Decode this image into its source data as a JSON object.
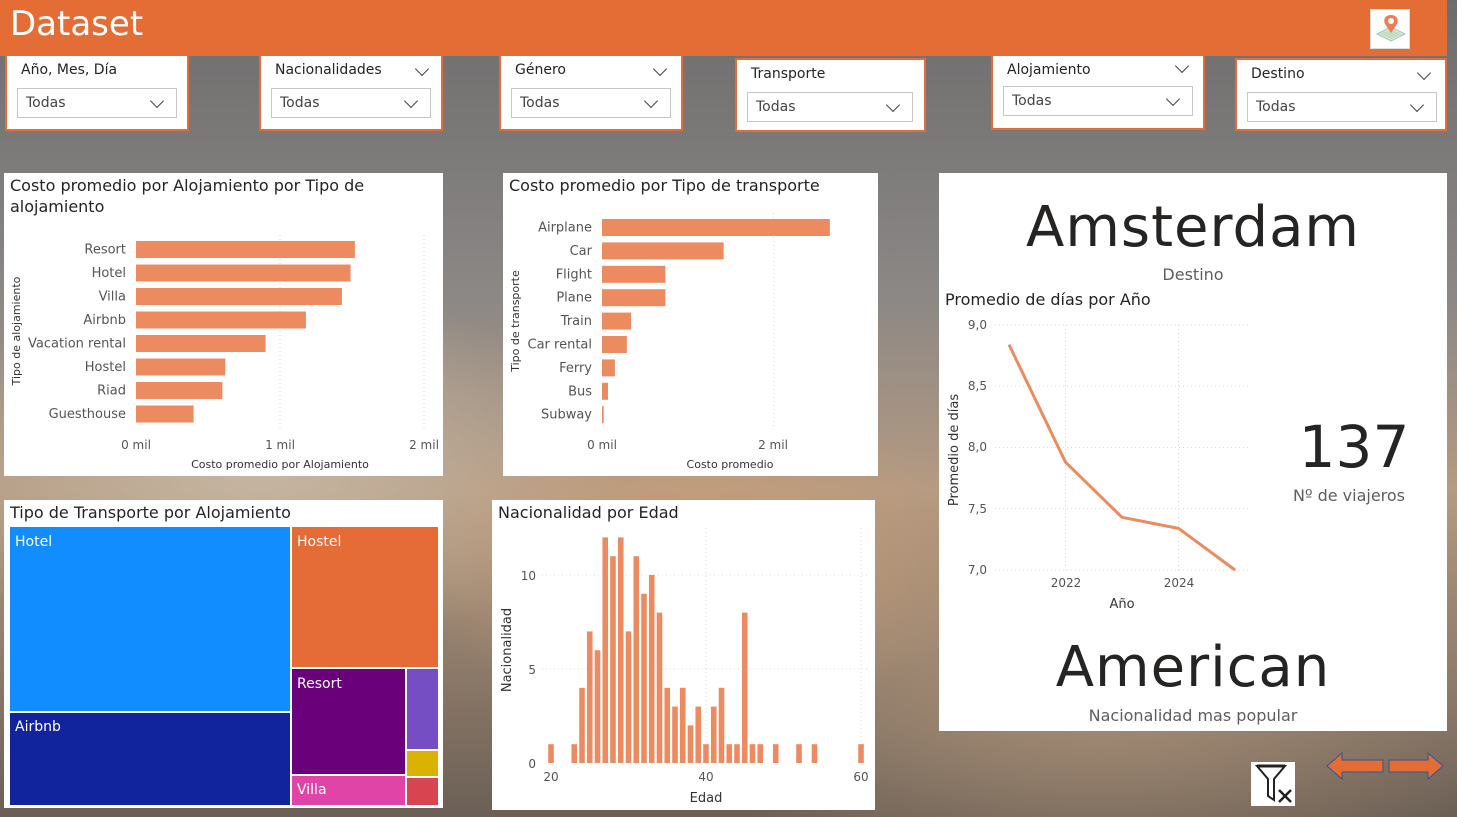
{
  "header": {
    "title": "Dataset"
  },
  "slicers": [
    {
      "label": "Año, Mes, Día",
      "value": "Todas"
    },
    {
      "label": "Nacionalidades",
      "value": "Todas"
    },
    {
      "label": "Género",
      "value": "Todas"
    },
    {
      "label": "Transporte",
      "value": "Todas"
    },
    {
      "label": "Alojamiento",
      "value": "Todas"
    },
    {
      "label": "Destino",
      "value": "Todas"
    }
  ],
  "accom_chart": {
    "title": "Costo promedio por Alojamiento por Tipo de alojamiento",
    "title_line1": "Costo promedio por Alojamiento por Tipo de",
    "title_line2": "alojamiento",
    "ylabel": "Tipo de alojamiento",
    "xlabel": "Costo promedio por Alojamiento",
    "ticks": [
      "0 mil",
      "1 mil",
      "2 mil"
    ]
  },
  "transport_chart": {
    "title": "Costo promedio por Tipo de transporte",
    "ylabel": "Tipo de transporte",
    "xlabel": "Costo promedio",
    "ticks": [
      "0 mil",
      "2 mil"
    ]
  },
  "treemap": {
    "title": "Tipo de Transporte por Alojamiento",
    "labels": {
      "hotel": "Hotel",
      "hostel": "Hostel",
      "airbnb": "Airbnb",
      "resort": "Resort",
      "villa": "Villa"
    },
    "colors": {
      "hotel": "#118dff",
      "hostel": "#e66c37",
      "airbnb": "#12239e",
      "resort": "#6b007b",
      "villa": "#e044a7",
      "small1": "#744ec2",
      "small2": "#d9b300",
      "small3": "#d64550"
    }
  },
  "histogram": {
    "title": "Nacionalidad por Edad",
    "ylabel": "Nacionalidad",
    "xlabel": "Edad",
    "yticks": [
      "0",
      "5",
      "10"
    ],
    "xticks": [
      "20",
      "40",
      "60"
    ]
  },
  "kpi": {
    "destination": "Amsterdam",
    "destination_label": "Destino",
    "travelers": "137",
    "travelers_label": "Nº de viajeros",
    "nationality": "American",
    "nationality_label": "Nacionalidad mas popular"
  },
  "line_chart": {
    "title": "Promedio de días por Año",
    "ylabel": "Promedio de días",
    "xlabel": "Año",
    "yticks": [
      "9,0",
      "8,5",
      "8,0",
      "7,5",
      "7,0"
    ],
    "xticks": [
      "2022",
      "2024"
    ]
  },
  "chart_data": [
    {
      "type": "bar",
      "orientation": "horizontal",
      "title": "Costo promedio por Alojamiento por Tipo de alojamiento",
      "xlabel": "Costo promedio por Alojamiento",
      "ylabel": "Tipo de alojamiento",
      "categories": [
        "Resort",
        "Hotel",
        "Villa",
        "Airbnb",
        "Vacation rental",
        "Hostel",
        "Riad",
        "Guesthouse"
      ],
      "values": [
        1520,
        1490,
        1430,
        1180,
        900,
        620,
        600,
        400
      ],
      "xlim": [
        0,
        2000
      ],
      "color": "#ec8b5f"
    },
    {
      "type": "bar",
      "orientation": "horizontal",
      "title": "Costo promedio por Tipo de transporte",
      "xlabel": "Costo promedio",
      "ylabel": "Tipo de transporte",
      "categories": [
        "Airplane",
        "Car",
        "Flight",
        "Plane",
        "Train",
        "Car rental",
        "Ferry",
        "Bus",
        "Subway"
      ],
      "values": [
        2660,
        1420,
        740,
        740,
        340,
        290,
        150,
        70,
        20
      ],
      "xlim": [
        0,
        3000
      ],
      "color": "#ec8b5f"
    },
    {
      "type": "bar",
      "title": "Nacionalidad por Edad",
      "xlabel": "Edad",
      "ylabel": "Nacionalidad",
      "x": [
        20,
        23,
        24,
        25,
        26,
        27,
        28,
        29,
        30,
        31,
        32,
        33,
        34,
        35,
        36,
        37,
        38,
        39,
        40,
        41,
        42,
        43,
        44,
        45,
        46,
        47,
        49,
        52,
        54,
        60
      ],
      "values": [
        1,
        1,
        4,
        7,
        6,
        12,
        11,
        12,
        7,
        11,
        9,
        10,
        8,
        4,
        3,
        4,
        2,
        3,
        1,
        3,
        4,
        1,
        1,
        8,
        1,
        1,
        1,
        1,
        1,
        1
      ],
      "xlim": [
        19,
        61
      ],
      "ylim": [
        0,
        12.5
      ],
      "color": "#ec8b5f"
    },
    {
      "type": "line",
      "title": "Promedio de días por Año",
      "xlabel": "Año",
      "ylabel": "Promedio de días",
      "x": [
        2021,
        2022,
        2023,
        2024,
        2025
      ],
      "values": [
        8.84,
        7.88,
        7.43,
        7.34,
        7.0
      ],
      "xlim": [
        2020.5,
        2025.5
      ],
      "ylim": [
        7.0,
        9.0
      ],
      "color": "#ec8b5f"
    }
  ]
}
